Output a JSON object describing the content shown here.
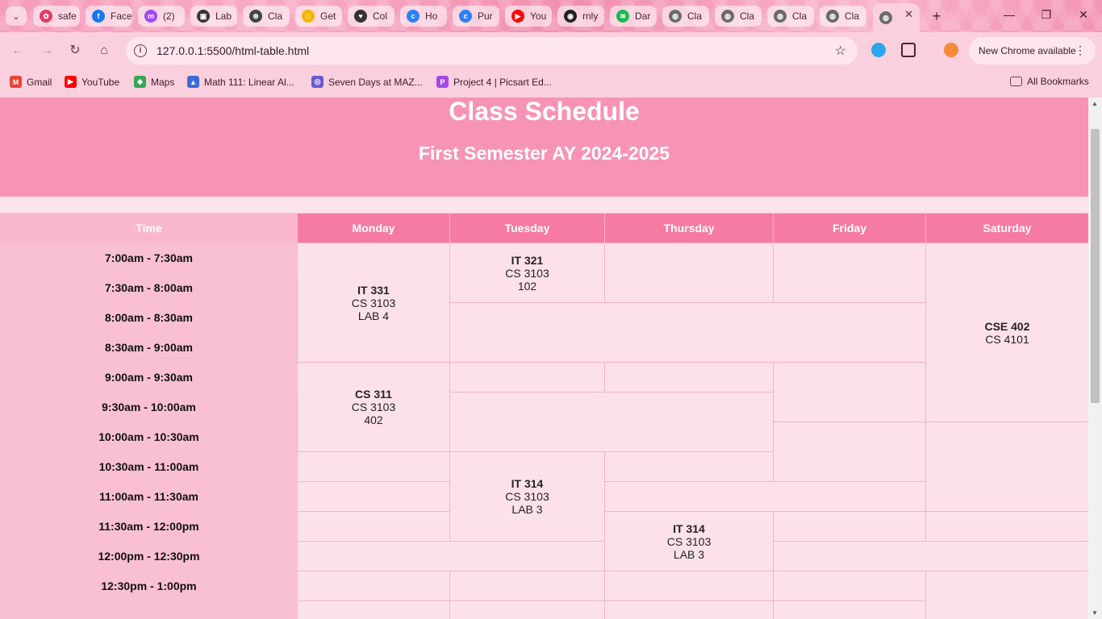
{
  "browser": {
    "tabs": [
      {
        "title": "safe",
        "color": "#e23b66",
        "glyph": "✿"
      },
      {
        "title": "Face",
        "color": "#1877f2",
        "glyph": "f"
      },
      {
        "title": "(2)",
        "color": "#a347ff",
        "glyph": "m"
      },
      {
        "title": "Lab",
        "color": "#333333",
        "glyph": "▣"
      },
      {
        "title": "Cla",
        "color": "#444444",
        "glyph": "⊛"
      },
      {
        "title": "Get",
        "color": "#f4b400",
        "glyph": "☺"
      },
      {
        "title": "Col",
        "color": "#333333",
        "glyph": "♥"
      },
      {
        "title": "Ho",
        "color": "#2d7ff9",
        "glyph": "c"
      },
      {
        "title": "Pur",
        "color": "#2d7ff9",
        "glyph": "c"
      },
      {
        "title": "You",
        "color": "#ff0000",
        "glyph": "▶"
      },
      {
        "title": "rnly",
        "color": "#222222",
        "glyph": "◉"
      },
      {
        "title": "Dar",
        "color": "#1db954",
        "glyph": "≋"
      },
      {
        "title": "Cla",
        "color": "#6b6b6b",
        "glyph": "◍"
      },
      {
        "title": "Cla",
        "color": "#6b6b6b",
        "glyph": "◍"
      },
      {
        "title": "Cla",
        "color": "#6b6b6b",
        "glyph": "◍"
      },
      {
        "title": "Cla",
        "color": "#6b6b6b",
        "glyph": "◍"
      }
    ],
    "active_tab_icon": "globe-icon",
    "url": "127.0.0.1:5500/html-table.html",
    "update_label": "New Chrome available",
    "bookmarks": [
      {
        "label": "Gmail",
        "color": "#ea4335",
        "glyph": "M"
      },
      {
        "label": "YouTube",
        "color": "#ff0000",
        "glyph": "▶"
      },
      {
        "label": "Maps",
        "color": "#34a853",
        "glyph": "◆"
      },
      {
        "label": "Math 111: Linear Al...",
        "color": "#3c6cd8",
        "glyph": "▲"
      },
      {
        "label": "Seven Days at MAZ...",
        "color": "#6a5acd",
        "glyph": "◎"
      },
      {
        "label": "Project 4 | Picsart Ed...",
        "color": "#a24be6",
        "glyph": "P"
      }
    ],
    "all_bookmarks_label": "All Bookmarks"
  },
  "page": {
    "title": "Class Schedule",
    "subtitle": "First Semester AY 2024-2025",
    "headers": {
      "time": "Time",
      "monday": "Monday",
      "tuesday": "Tuesday",
      "thursday": "Thursday",
      "friday": "Friday",
      "saturday": "Saturday"
    },
    "times": [
      "7:00am - 7:30am",
      "7:30am - 8:00am",
      "8:00am - 8:30am",
      "8:30am - 9:00am",
      "9:00am - 9:30am",
      "9:30am - 10:00am",
      "10:00am - 10:30am",
      "10:30am - 11:00am",
      "11:00am - 11:30am",
      "11:30am - 12:00pm",
      "12:00pm - 12:30pm",
      "12:30pm - 1:00pm"
    ],
    "classes": {
      "mon_it331": {
        "code": "IT 331",
        "room": "CS 3103",
        "extra": "LAB 4"
      },
      "tue_it321": {
        "code": "IT 321",
        "room": "CS 3103",
        "extra": "102"
      },
      "sat_cse402": {
        "code": "CSE 402",
        "room": "CS 4101"
      },
      "mon_cs311": {
        "code": "CS 311",
        "room": "CS 3103",
        "extra": "402"
      },
      "tue_it314": {
        "code": "IT 314",
        "room": "CS 3103",
        "extra": "LAB 3"
      },
      "thu_it314": {
        "code": "IT 314",
        "room": "CS 3103",
        "extra": "LAB 3"
      }
    }
  },
  "colors": {
    "header_row": "#f57ba3",
    "banner": "#f794b6",
    "cell": "#fde1ea",
    "time_col": "#f8c0d1"
  }
}
